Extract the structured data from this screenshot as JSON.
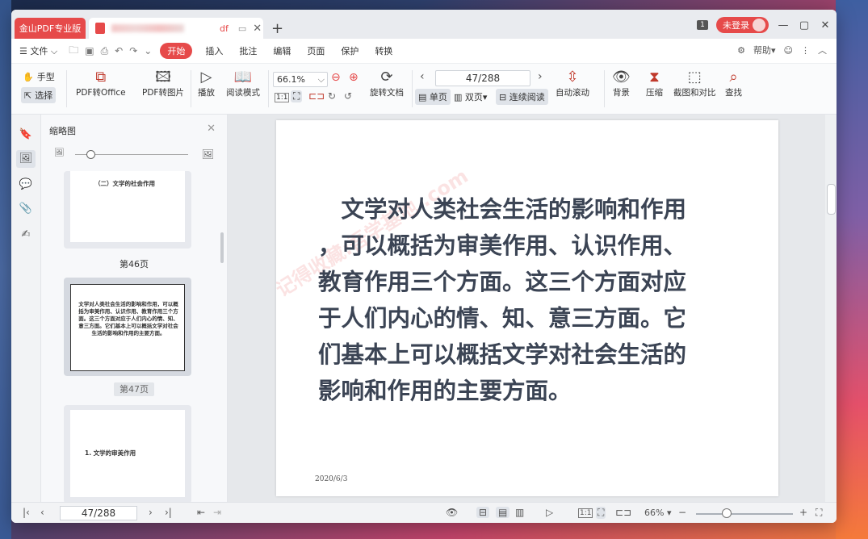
{
  "titlebar": {
    "app_tab": "金山PDF专业版",
    "doc_tab_suffix": "df",
    "new_tab_symbol": "+",
    "page_badge": "1",
    "login_label": "未登录"
  },
  "menubar": {
    "file": "文件",
    "tabs": [
      "开始",
      "插入",
      "批注",
      "编辑",
      "页面",
      "保护",
      "转换"
    ],
    "help": "帮助"
  },
  "toolbar": {
    "hand": "手型",
    "select": "选择",
    "pdf_to_office": "PDF转Office",
    "pdf_to_image": "PDF转图片",
    "play": "播放",
    "read_mode": "阅读模式",
    "zoom_value": "66.1%",
    "rotate_doc": "旋转文档",
    "page_input": "47/288",
    "single_page": "单页",
    "double_page": "双页",
    "continuous": "连续阅读",
    "auto_scroll": "自动滚动",
    "background": "背景",
    "compress": "压缩",
    "screenshot_compare": "截图和对比",
    "find": "查找"
  },
  "thumbnails": {
    "title": "缩略图",
    "items": [
      {
        "content": "（二）文学的社会作用",
        "label": "第46页"
      },
      {
        "content": "文学对人类社会生活的影响和作用，可以概括为审美作用、认识作用、教育作用三个方面。这三个方面对应于人们内心的情、知、意三方面。它们基本上可以概括文学对社会生活的影响和作用的主要方面。",
        "label": "第47页"
      },
      {
        "content": "1. 文学的审美作用",
        "label": ""
      }
    ]
  },
  "document": {
    "paragraph_lines": [
      "　文学对人类社会生活的影响和作用",
      "，可以概括为审美作用、认识作用、",
      "教育作用三个方面。这三个方面对应",
      "于人们内心的情、知、意三方面。它",
      "们基本上可以概括文学对社会生活的",
      "影响和作用的主要方面。"
    ],
    "date": "2020/6/3",
    "watermark": "记得收藏:吾学基地 .com"
  },
  "statusbar": {
    "page_input": "47/288",
    "zoom": "66%"
  },
  "colors": {
    "accent": "#e64a4a",
    "text_dark": "#3b4454"
  }
}
